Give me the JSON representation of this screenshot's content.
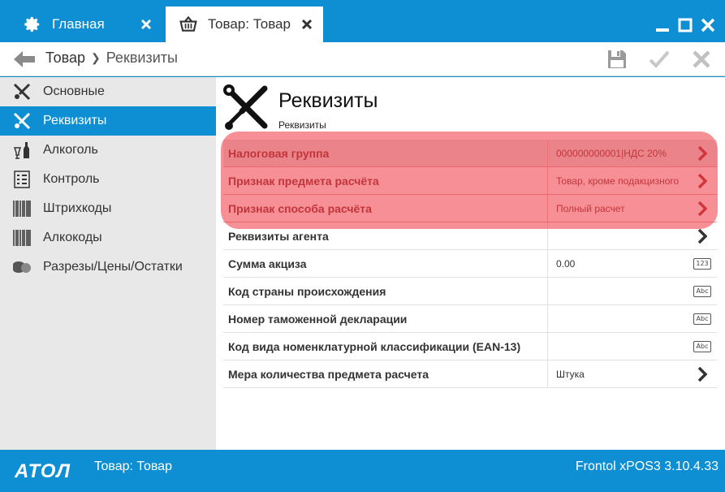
{
  "tabs": [
    {
      "label": "Главная",
      "icon": "gear-icon"
    },
    {
      "label": "Товар: Товар",
      "icon": "basket-icon"
    }
  ],
  "breadcrumb": {
    "root": "Товар",
    "current": "Реквизиты"
  },
  "sidebar": {
    "items": [
      {
        "label": "Основные",
        "icon": "tools-icon",
        "active": false
      },
      {
        "label": "Реквизиты",
        "icon": "tools-icon",
        "active": true
      },
      {
        "label": "Алкоголь",
        "icon": "bottle-icon",
        "active": false
      },
      {
        "label": "Контроль",
        "icon": "checklist-icon",
        "active": false
      },
      {
        "label": "Штрихкоды",
        "icon": "barcode-icon",
        "active": false
      },
      {
        "label": "Алкокоды",
        "icon": "barcode-icon",
        "active": false
      },
      {
        "label": "Разрезы/Цены/Остатки",
        "icon": "coins-icon",
        "active": false
      }
    ]
  },
  "main": {
    "title": "Реквизиты",
    "subtitle": "Реквизиты",
    "rows": [
      {
        "label": "Налоговая группа",
        "value": "000000000001|НДС 20%",
        "action": "chevron"
      },
      {
        "label": "Признак предмета расчёта",
        "value": "Товар, кроме подакцизного",
        "action": "chevron"
      },
      {
        "label": "Признак способа расчёта",
        "value": "Полный расчет",
        "action": "chevron"
      },
      {
        "label": "Реквизиты агента",
        "value": "",
        "action": "chevron"
      },
      {
        "label": "Сумма акциза",
        "value": "0.00",
        "action": "badge",
        "badge": "123"
      },
      {
        "label": "Код страны происхождения",
        "value": "",
        "action": "badge",
        "badge": "Abc"
      },
      {
        "label": "Номер таможенной декларации",
        "value": "",
        "action": "badge",
        "badge": "Abc"
      },
      {
        "label": "Код вида номенклатурной классификации (EAN-13)",
        "value": "",
        "action": "badge",
        "badge": "Abc"
      },
      {
        "label": "Мера количества предмета расчета",
        "value": "Штука",
        "action": "chevron"
      }
    ]
  },
  "footer": {
    "logo": "ATOЛ",
    "title": "Товар: Товар",
    "version": "Frontol xPOS3 3.10.4.33"
  },
  "colors": {
    "accent": "#0e8fd4",
    "highlight": "#f04650"
  }
}
